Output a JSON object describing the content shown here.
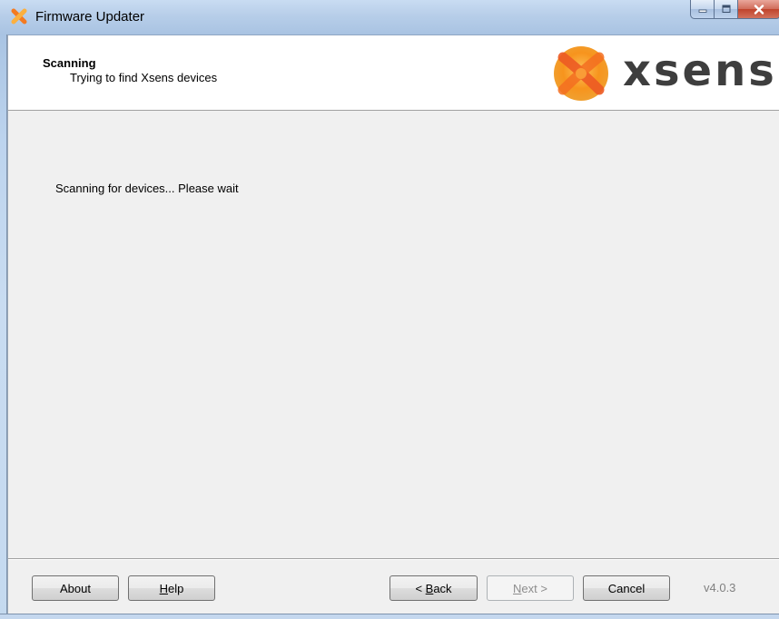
{
  "window": {
    "title": "Firmware Updater",
    "icon": "xsens-x-icon"
  },
  "caption_buttons": {
    "minimize": "minimize-icon",
    "maximize": "maximize-icon",
    "close": "close-icon"
  },
  "header": {
    "title": "Scanning",
    "subtitle": "Trying to find Xsens devices",
    "logo_text": "xsens"
  },
  "main": {
    "status": "Scanning for devices... Please wait"
  },
  "footer": {
    "about_label": "About",
    "help_label": "Help",
    "back_label": "< Back",
    "next_label": "Next >",
    "cancel_label": "Cancel",
    "version": "v4.0.3",
    "next_enabled": false
  },
  "colors": {
    "brand_orange": "#f7941d",
    "logo_text": "#3e3e3e",
    "close_button": "#c9503a"
  }
}
